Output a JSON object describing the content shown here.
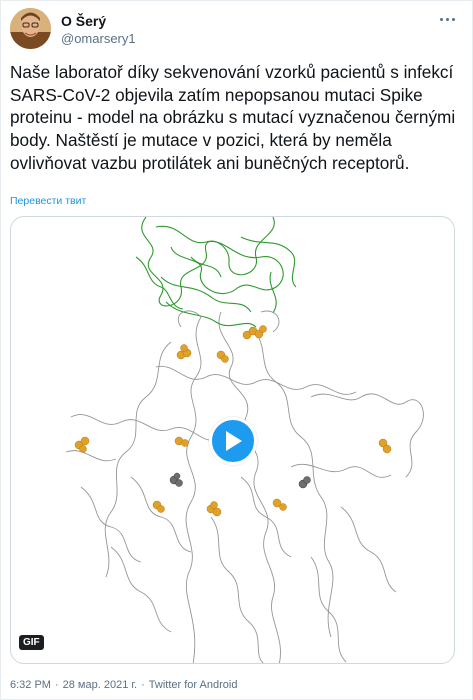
{
  "author": {
    "display_name": "O Šerý",
    "handle": "@omarsery1",
    "avatar_icon": "avatar-photo"
  },
  "tweet": {
    "text": "Naše laboratoř díky sekvenování vzorků pacientů s infekcí SARS-CoV-2 objevila zatím nepopsanou mutaci Spike proteinu - model na obrázku s mutací vyznačenou černými body. Naštěstí je mutace v pozici, která by neměla ovlivňovat vazbu protilátek ani buněčných receptorů.",
    "translate_label": "Перевести твит"
  },
  "media": {
    "badge": "GIF",
    "play_icon": "play-icon",
    "colors": {
      "backbone": "#8a8a8a",
      "receptor": "#2e9a2e",
      "sugar": "#e0a12a",
      "mutation": "#6e6e6e",
      "play": "#1d9bf0"
    }
  },
  "meta": {
    "time": "6:32 PM",
    "date": "28 мар. 2021 г.",
    "separator": "·",
    "source": "Twitter for Android"
  },
  "menu": {
    "icon": "more-options-icon"
  }
}
